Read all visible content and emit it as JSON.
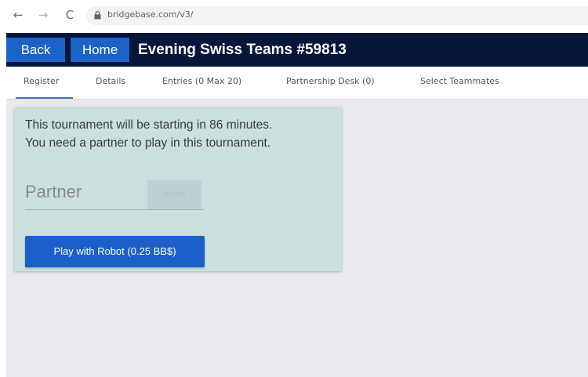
{
  "browser": {
    "back_glyph": "←",
    "forward_glyph": "→",
    "reload_glyph": "C",
    "url": "bridgebase.com/v3/"
  },
  "header": {
    "back_label": "Back",
    "home_label": "Home",
    "title": "Evening Swiss Teams #59813"
  },
  "tabs": [
    {
      "label": "Register",
      "active": true
    },
    {
      "label": "Details",
      "active": false
    },
    {
      "label": "Entries (0 Max 20)",
      "active": false
    },
    {
      "label": "Partnership Desk (0)",
      "active": false
    },
    {
      "label": "Select Teammates",
      "active": false
    }
  ],
  "card": {
    "message_line1": "This tournament will be starting in 86 minutes.",
    "message_line2": "You need a partner to play in this tournament.",
    "partner_placeholder": "Partner",
    "invite_label": "Invite",
    "robot_button_label": "Play with Robot (0.25 BB$)"
  },
  "colors": {
    "header_bg": "#05163a",
    "button_blue": "#1b63c8",
    "card_bg": "#c9e0df",
    "content_bg": "#e8eaed"
  }
}
